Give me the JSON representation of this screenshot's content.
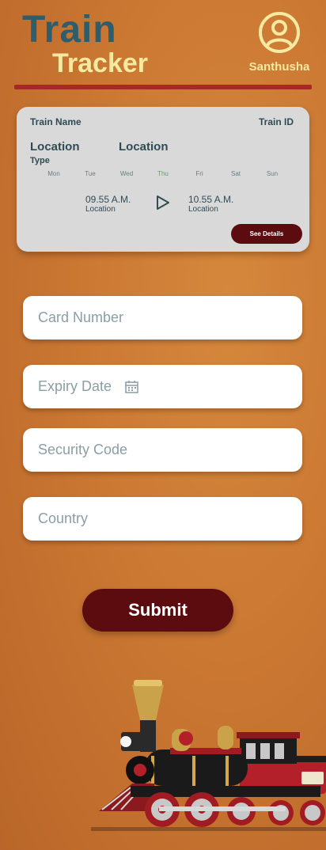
{
  "header": {
    "logo_line1": "Train",
    "logo_line2": "Tracker",
    "username": "Santhusha",
    "profile_icon": "user-circle-icon"
  },
  "train_card": {
    "train_name": "Train Name",
    "train_id": "Train ID",
    "from_location": "Location",
    "to_location": "Location",
    "type": "Type",
    "days": [
      "Mon",
      "Tue",
      "Wed",
      "Thu",
      "Fri",
      "Sat",
      "Sun"
    ],
    "active_day": "Thu",
    "departure_time": "09.55 A.M.",
    "departure_location": "Location",
    "arrival_time": "10.55 A.M.",
    "arrival_location": "Location",
    "see_details_label": "See Details"
  },
  "form": {
    "card_number_placeholder": "Card Number",
    "expiry_date_placeholder": "Expiry Date",
    "security_code_placeholder": "Security Code",
    "country_placeholder": "Country",
    "submit_label": "Submit"
  },
  "colors": {
    "background": "#cb7833",
    "logo_primary": "#2f5d6b",
    "logo_secondary": "#f6eaa0",
    "divider": "#a8282a",
    "button": "#5c0c0f",
    "active_day": "#4caf50"
  }
}
